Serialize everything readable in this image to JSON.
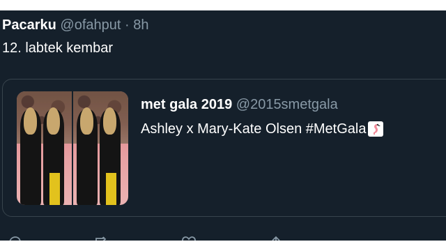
{
  "tweet": {
    "display_name": "Pacarku",
    "handle": "@ofahput",
    "separator": "·",
    "time": "8h",
    "text": "12. labtek kembar"
  },
  "quoted_tweet": {
    "display_name": "met gala 2019",
    "handle": "@2015smetgala",
    "text": "Ashley x Mary-Kate Olsen #MetGala",
    "emoji_icon": "flamingo-icon",
    "media": {
      "photo_count": 2
    }
  },
  "actions": [
    {
      "icon": "reply-icon"
    },
    {
      "icon": "retweet-icon"
    },
    {
      "icon": "like-icon"
    },
    {
      "icon": "share-icon"
    }
  ],
  "colors": {
    "background": "#15202b",
    "primary_text": "#ffffff",
    "secondary_text": "#8899a6",
    "border": "#38444d"
  }
}
